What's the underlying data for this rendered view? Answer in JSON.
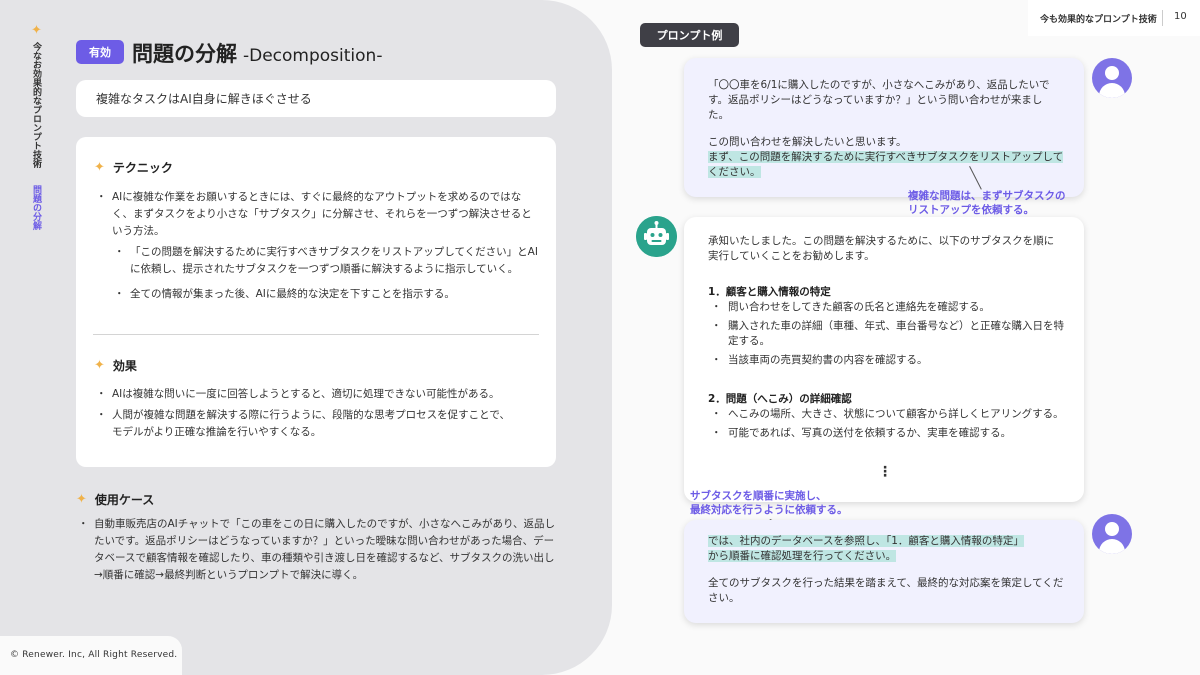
{
  "sidebar": {
    "vertical_title": "今なお効果的なプロンプト技術",
    "vertical_section": "問題の分解"
  },
  "header": {
    "badge": "有効",
    "title": "問題の分解",
    "title_en": "-Decomposition-",
    "subtitle": "複雑なタスクはAI自身に解きほぐさせる"
  },
  "technique": {
    "heading": "テクニック",
    "items": [
      "AIに複雑な作業をお願いするときには、すぐに最終的なアウトプットを求めるのではなく、まずタスクをより小さな「サブタスク」に分解させ、それらを一つずつ解決させるという方法。",
      "「この問題を解決するために実行すべきサブタスクをリストアップしてください」とAIに依頼し、提示されたサブタスクを一つずつ順番に解決するように指示していく。",
      "全ての情報が集まった後、AIに最終的な決定を下すことを指示する。"
    ]
  },
  "effect": {
    "heading": "効果",
    "items": [
      "AIは複雑な問いに一度に回答しようとすると、適切に処理できない可能性がある。",
      "人間が複雑な問題を解決する際に行うように、段階的な思考プロセスを促すことで、モデルがより正確な推論を行いやすくなる。"
    ]
  },
  "usecase": {
    "heading": "使用ケース",
    "items": [
      "自動車販売店のAIチャットで「この車をこの日に購入したのですが、小さなへこみがあり、返品したいです。返品ポリシーはどうなっていますか？」といった曖昧な問い合わせがあった場合、データベースで顧客情報を確認したり、車の種類や引き渡し日を確認するなど、サブタスクの洗い出し→順番に確認→最終判断というプロンプトで解決に導く。"
    ]
  },
  "footer": {
    "copyright": "© Renewer. Inc, All Right Reserved."
  },
  "top_right": {
    "deck_title": "今も効果的なプロンプト技術",
    "page_number": "10"
  },
  "prompt_label": "プロンプト例",
  "chat": {
    "user1": {
      "p1": "「〇〇車を6/1に購入したのですが、小さなへこみがあり、返品したいです。返品ポリシーはどうなっていますか？」という問い合わせが来ました。",
      "p2": "この問い合わせを解決したいと思います。",
      "p3_highlight": "まず、この問題を解決するために実行すべきサブタスクをリストアップしてください。"
    },
    "annotation1_line1": "複雑な問題は、まずサブタスクの",
    "annotation1_line2": "リストアップを依頼する。",
    "bot": {
      "intro": "承知いたしました。この問題を解決するために、以下のサブタスクを順に実行していくことをお勧めします。",
      "h1": "1．顧客と購入情報の特定",
      "h1_items": [
        "問い合わせをしてきた顧客の氏名と連絡先を確認する。",
        "購入された車の詳細（車種、年式、車台番号など）と正確な購入日を特定する。",
        "当該車両の売買契約書の内容を確認する。"
      ],
      "h2": "2．問題（へこみ）の詳細確認",
      "h2_items": [
        "へこみの場所、大きさ、状態について顧客から詳しくヒアリングする。",
        "可能であれば、写真の送付を依頼するか、実車を確認する。"
      ],
      "more": "⋮"
    },
    "annotation2_line1": "サブタスクを順番に実施し、",
    "annotation2_line2": "最終対応を行うように依頼する。",
    "user2": {
      "hl_part1": "では、社内のデータベースを参照し、「1．顧客と購入情報の特定」",
      "hl_part2": "から順番に確認処理を行ってください。",
      "p2": "全てのサブタスクを行った結果を踏まえて、最終的な対応案を策定してください。"
    }
  },
  "colors": {
    "accent": "#6d5ce6",
    "star": "#f0b24a",
    "highlight": "#bfe6e3",
    "bot": "#2aa38c",
    "panel": "#e4e4e7"
  },
  "icons": [
    "sparkle-star-icon",
    "user-avatar-icon",
    "robot-avatar-icon",
    "vertical-ellipsis-icon"
  ]
}
